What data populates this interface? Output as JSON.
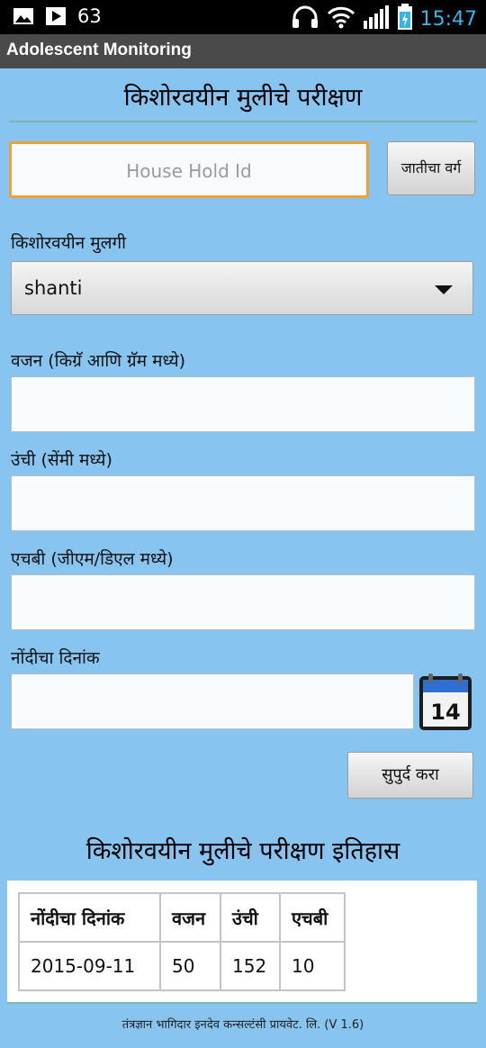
{
  "status_bar": {
    "notification_count": "63",
    "time": "15:47",
    "icons": [
      "image-icon",
      "play-icon",
      "headphones-icon",
      "wifi-icon",
      "signal-icon",
      "battery-charging-icon"
    ]
  },
  "app": {
    "title": "Adolescent Monitoring"
  },
  "page": {
    "heading": "किशोरवयीन मुलीचे परीक्षण"
  },
  "form": {
    "household_placeholder": "House Hold Id",
    "caste_button": "जातीचा वर्ग",
    "girl_label": "किशोरवयीन मुलगी",
    "girl_selected": "shanti",
    "weight_label": "वजन (किग्रॅ आणि ग्रॅम मध्ये)",
    "height_label": "उंची (सेंमी मध्ये)",
    "hb_label": "एचबी (जीएम/डिएल मध्ये)",
    "date_label": "नोंदीचा दिनांक",
    "calendar_day": "14",
    "submit_button": "सुपुर्द करा"
  },
  "history": {
    "heading": "किशोरवयीन मुलीचे परीक्षण इतिहास",
    "columns": [
      "नोंदीचा दिनांक",
      "वजन",
      "उंची",
      "एचबी"
    ],
    "rows": [
      [
        "2015-09-11",
        "50",
        "152",
        "10"
      ]
    ]
  },
  "footer": {
    "text": "तंत्रज्ञान भागिदार इनदेव कन्सल्टंसी प्रायवेट. लि. (V 1.6)"
  },
  "colors": {
    "background": "#87c4ef",
    "title_bar": "#4a4a4a",
    "focus_border": "#f2a033",
    "time": "#33b5e5"
  }
}
